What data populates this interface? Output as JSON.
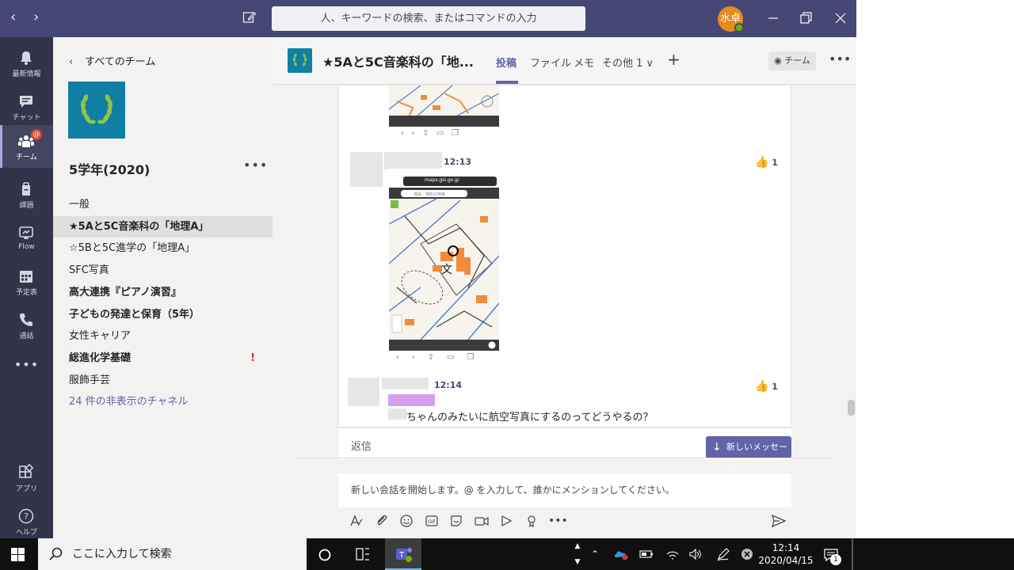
{
  "titlebar": {
    "search_placeholder": "人、キーワードの検索、またはコマンドの入力",
    "avatar_initials": "水卓"
  },
  "rail": {
    "items": [
      {
        "label": "最新情報",
        "icon": "bell-icon"
      },
      {
        "label": "チャット",
        "icon": "chat-icon"
      },
      {
        "label": "チーム",
        "icon": "teams-icon",
        "badge": "@"
      },
      {
        "label": "課題",
        "icon": "assignment-icon"
      },
      {
        "label": "Flow",
        "icon": "flow-icon"
      },
      {
        "label": "予定表",
        "icon": "calendar-icon"
      },
      {
        "label": "通話",
        "icon": "phone-icon"
      },
      {
        "label": "•••",
        "icon": "more-icon"
      },
      {
        "label": "アプリ",
        "icon": "apps-icon"
      },
      {
        "label": "ヘルプ",
        "icon": "help-icon"
      }
    ]
  },
  "panel": {
    "back_label": "すべてのチーム",
    "team_name": "5学年(2020)",
    "more": "•••",
    "channels": [
      {
        "label": "一般"
      },
      {
        "label": "★5Aと5C音楽科の「地理A」"
      },
      {
        "label": "☆5Bと5C進学の「地理A」"
      },
      {
        "label": "SFC写真"
      },
      {
        "label": "高大連携『ピアノ演習』"
      },
      {
        "label": "子どもの発達と保育（5年）"
      },
      {
        "label": "女性キャリア"
      },
      {
        "label": "総進化学基礎",
        "flag": "!"
      },
      {
        "label": "服飾手芸"
      },
      {
        "label": "24 件の非表示のチャネル"
      }
    ]
  },
  "header": {
    "title": "★5Aと5C音楽科の「地...",
    "tabs": [
      "投稿",
      "ファイル",
      "メモ",
      "その他 1 ∨"
    ],
    "add": "+",
    "team_button": "チーム",
    "more": "•••"
  },
  "messages": [
    {
      "time": "12:13",
      "reaction": "1",
      "phone_url": "maps.gsi.go.jp",
      "map_search_hint": "地図・場所の検索"
    },
    {
      "time": "12:14",
      "reaction": "1",
      "text": "ちゃんのみたいに航空写真にするのってどうやるの？"
    }
  ],
  "reply": {
    "label": "返信",
    "new_messages": "新しいメッセージ"
  },
  "compose": {
    "placeholder": "新しい会話を開始します。@ を入力して、誰かにメンションしてください。"
  },
  "taskbar": {
    "search_placeholder": "ここに入力して検索",
    "time": "12:14",
    "date": "2020/04/15",
    "notification_count": "1"
  },
  "colors": {
    "titlebar": "#464775",
    "rail": "#33344a",
    "accent": "#6264a7",
    "map_orange": "#f08c3c",
    "map_blue": "#4a7fd0"
  }
}
